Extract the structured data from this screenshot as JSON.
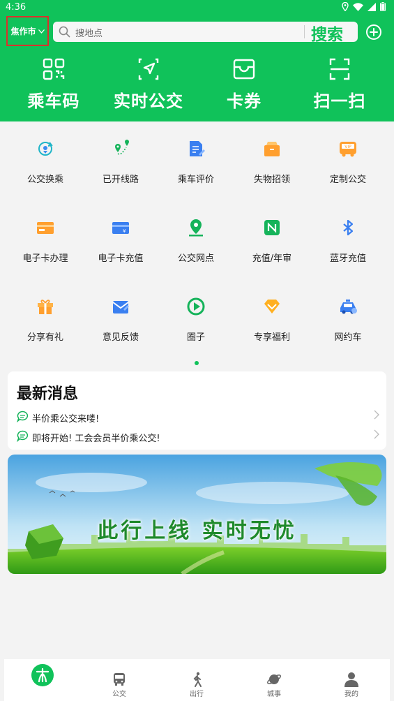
{
  "status": {
    "time": "4:36"
  },
  "header": {
    "city": "焦作市",
    "search_placeholder": "搜地点",
    "search_button": "搜索",
    "brand_color": "#10c25a"
  },
  "quick_actions": [
    {
      "label": "乘车码",
      "icon": "qr-code-icon"
    },
    {
      "label": "实时公交",
      "icon": "navigation-arrow-icon"
    },
    {
      "label": "卡券",
      "icon": "coupon-icon"
    },
    {
      "label": "扫一扫",
      "icon": "scan-icon"
    }
  ],
  "services": [
    {
      "label": "公交换乘",
      "icon": "transfer-icon"
    },
    {
      "label": "已开线路",
      "icon": "route-icon"
    },
    {
      "label": "乘车评价",
      "icon": "review-icon"
    },
    {
      "label": "失物招领",
      "icon": "lost-found-icon"
    },
    {
      "label": "定制公交",
      "icon": "custom-bus-icon"
    },
    {
      "label": "电子卡办理",
      "icon": "ecard-icon"
    },
    {
      "label": "电子卡充值",
      "icon": "ecard-recharge-icon"
    },
    {
      "label": "公交网点",
      "icon": "location-pin-icon"
    },
    {
      "label": "充值/年审",
      "icon": "nfc-icon"
    },
    {
      "label": "蓝牙充值",
      "icon": "bluetooth-icon"
    },
    {
      "label": "分享有礼",
      "icon": "gift-icon"
    },
    {
      "label": "意见反馈",
      "icon": "feedback-mail-icon"
    },
    {
      "label": "圈子",
      "icon": "circle-play-icon"
    },
    {
      "label": "专享福利",
      "icon": "diamond-icon"
    },
    {
      "label": "网约车",
      "icon": "taxi-icon"
    }
  ],
  "news": {
    "title": "最新消息",
    "items": [
      {
        "text": "半价乘公交来喽!"
      },
      {
        "text": "即将开始! 工会会员半价乘公交!"
      }
    ]
  },
  "banner": {
    "slogan": "此行上线 实时无忧"
  },
  "tabs": [
    {
      "label": "",
      "icon": "home-logo-icon"
    },
    {
      "label": "公交",
      "icon": "bus-icon"
    },
    {
      "label": "出行",
      "icon": "walking-icon"
    },
    {
      "label": "城事",
      "icon": "planet-icon"
    },
    {
      "label": "我的",
      "icon": "person-icon"
    }
  ]
}
